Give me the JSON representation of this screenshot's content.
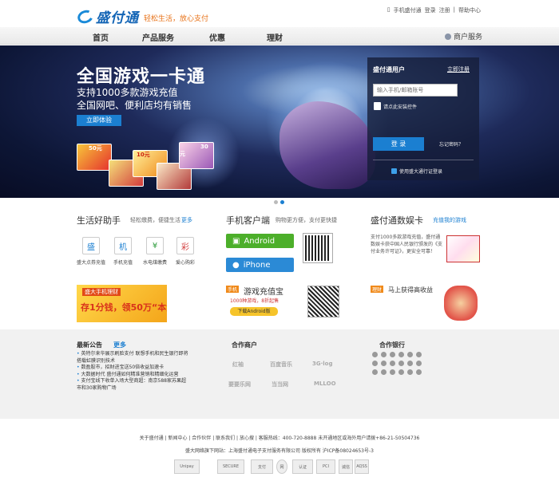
{
  "header": {
    "logo_text": "盛付通",
    "slogan": "轻松生活，放心支付",
    "top_links": [
      "手机盛付通",
      "登录",
      "注册",
      "帮助中心"
    ]
  },
  "nav": {
    "items": [
      "首页",
      "产品服务",
      "优惠",
      "理财"
    ],
    "merchant": "商户服务"
  },
  "banner": {
    "title": "全国游戏一卡通",
    "sub1": "支持1000多款游戏充值",
    "sub2": "全国网吧、便利店均有销售",
    "cta": "立即体验",
    "cards": [
      "50元",
      "10元",
      "30元"
    ]
  },
  "login": {
    "title": "盛付通用户",
    "register": "立即注册",
    "placeholder": "输入手机/邮箱账号",
    "plugin": "请点此安装控件",
    "button": "登 录",
    "forgot": "忘记密码？",
    "sd_login": "使用盛大通行证登录"
  },
  "life": {
    "title": "生活好助手",
    "sub": "轻松缴费，便捷生活",
    "more": "更多",
    "services": [
      {
        "icon": "盛",
        "label": "盛大点券充值"
      },
      {
        "icon": "机",
        "label": "手机充值"
      },
      {
        "icon": "¥",
        "label": "水电煤缴费"
      },
      {
        "icon": "彩",
        "label": "爱心购彩"
      }
    ],
    "promo_tag": "盛大手机理财",
    "promo_text": "存1分钱，领50万“本金”"
  },
  "mobile": {
    "title": "手机客户端",
    "sub": "购物更方便，支付更快捷",
    "android": "Android",
    "iphone": "iPhone",
    "wallet_tag": "手机",
    "wallet_title": "游戏充值宝",
    "wallet_desc": "1000种游戏，8折起售",
    "wallet_btn": "下载Android版"
  },
  "game": {
    "title": "盛付通数娱卡",
    "link": "充值我的游戏",
    "desc": "支付1000多款游戏充值，盛付通数娱卡获中国人民银行颁发的《支付业务许可证》，更安全可靠！",
    "licai_tag": "理财",
    "licai_text": "马上获得高收益"
  },
  "notice": {
    "title": "最新公告",
    "more": "更多",
    "items": [
      "英特尔来华展示刷脸支付 联想手机和民生银行即将搭载虹膜识别技术",
      "数盈股市，招财进宝送50倍收益加速卡",
      "大数据时代 盛付通如何精准营销和精细化运营",
      "支付宝线下收单入场大型商超：南京588家苏果超市和30家购物广场"
    ]
  },
  "partners": {
    "title": "合作商户",
    "items": [
      "红袖",
      "百度音乐",
      "3G·log",
      "要要乐网",
      "当当网",
      "MLLOO"
    ]
  },
  "banks": {
    "title": "合作银行"
  },
  "footer": {
    "links": "关于盛付通 | 新闻中心 | 合作伙伴 | 联系我们 | 放心搜 | 客服热线：400-720-8888 未开通地区或海外用户请拨+86-21-50504736",
    "copy": "盛大网络旗下网站：上海盛付通电子支付服务有限公司 版权所有 沪ICP备08024653号-3",
    "certs": [
      "Unipay",
      "SECURE",
      "支付",
      "网",
      "认证",
      "PCI",
      "诚信",
      "AQSS"
    ]
  }
}
